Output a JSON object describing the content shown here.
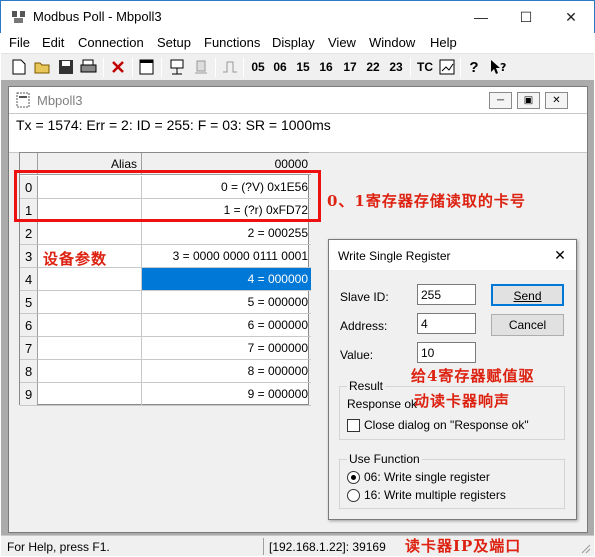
{
  "app": {
    "title": "Modbus Poll - Mbpoll3"
  },
  "menu": [
    "File",
    "Edit",
    "Connection",
    "Setup",
    "Functions",
    "Display",
    "View",
    "Window",
    "Help"
  ],
  "toolbar": {
    "function_codes": [
      "05",
      "06",
      "15",
      "16",
      "17",
      "22",
      "23"
    ],
    "tc_label": "TC"
  },
  "child": {
    "title": "Mbpoll3",
    "status": "Tx = 1574: Err = 2: ID = 255: F = 03: SR = 1000ms",
    "grid": {
      "alias_header": "Alias",
      "value_header": "00000",
      "rows": [
        {
          "index": "0",
          "value": "0 = (?V) 0x1E56"
        },
        {
          "index": "1",
          "value": "1 = (?r) 0xFD72"
        },
        {
          "index": "2",
          "value": "2 = 000255"
        },
        {
          "index": "3",
          "value": "3 = 0000 0000 0111 0001"
        },
        {
          "index": "4",
          "value": "4 = 000000",
          "selected": true
        },
        {
          "index": "5",
          "value": "5 = 000000"
        },
        {
          "index": "6",
          "value": "6 = 000000"
        },
        {
          "index": "7",
          "value": "7 = 000000"
        },
        {
          "index": "8",
          "value": "8 = 000000"
        },
        {
          "index": "9",
          "value": "9 = 000000"
        }
      ]
    }
  },
  "annotations": {
    "rows01": "0、1寄存器存储读取的卡号",
    "device_params": "设备参数",
    "write4": "给4寄存器赋值驱",
    "write4_line2": "动读卡器响声",
    "ip_port": "读卡器IP及端口"
  },
  "dialog": {
    "title": "Write Single Register",
    "slave_id_label": "Slave ID:",
    "slave_id_value": "255",
    "address_label": "Address:",
    "address_value": "4",
    "value_label": "Value:",
    "value_value": "10",
    "send_label": "Send",
    "cancel_label": "Cancel",
    "result_group": "Result",
    "result_text": "Response ok",
    "close_dialog_label": "Close dialog on \"Response ok\"",
    "use_function_group": "Use Function",
    "option_06": "06: Write single register",
    "option_16": "16: Write multiple registers"
  },
  "statusbar": {
    "help": "For Help, press F1.",
    "address": "[192.168.1.22]: 39169"
  },
  "colors": {
    "selection": "#0078d7",
    "annotation_red": "#dd2222",
    "title_border": "#2b79c2"
  }
}
